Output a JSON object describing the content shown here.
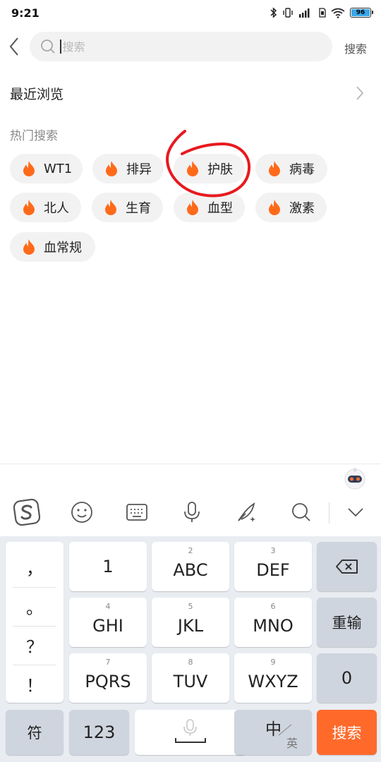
{
  "status_bar": {
    "time": "9:21",
    "battery": "96",
    "icons": [
      "bluetooth-icon",
      "vibrate-icon",
      "signal-icon",
      "sim-icon",
      "wifi-icon",
      "battery-icon"
    ]
  },
  "header": {
    "search_placeholder": "搜索",
    "search_action_label": "搜索"
  },
  "recent": {
    "title": "最近浏览"
  },
  "hot": {
    "title": "热门搜索",
    "tags": [
      {
        "label": "WT1"
      },
      {
        "label": "排异"
      },
      {
        "label": "护肤"
      },
      {
        "label": "病毒"
      },
      {
        "label": "北人"
      },
      {
        "label": "生育"
      },
      {
        "label": "血型"
      },
      {
        "label": "激素"
      },
      {
        "label": "血常规"
      }
    ],
    "flame_color": "#ff6a1a"
  },
  "annotation": {
    "color": "#e8191f"
  },
  "keyboard": {
    "punctuation": [
      "，",
      "。",
      "？",
      "！"
    ],
    "rows": [
      [
        {
          "sub": "",
          "main": "1"
        },
        {
          "sub": "2",
          "main": "ABC"
        },
        {
          "sub": "3",
          "main": "DEF"
        }
      ],
      [
        {
          "sub": "4",
          "main": "GHI"
        },
        {
          "sub": "5",
          "main": "JKL"
        },
        {
          "sub": "6",
          "main": "MNO"
        }
      ],
      [
        {
          "sub": "7",
          "main": "PQRS"
        },
        {
          "sub": "8",
          "main": "TUV"
        },
        {
          "sub": "9",
          "main": "WXYZ"
        }
      ]
    ],
    "reenter_label": "重输",
    "zero_label": "0",
    "symbol_label": "符",
    "num_label": "123",
    "zh_label": "中",
    "en_label": "英",
    "search_key_label": "搜索",
    "search_key_color": "#ff6a2b"
  }
}
